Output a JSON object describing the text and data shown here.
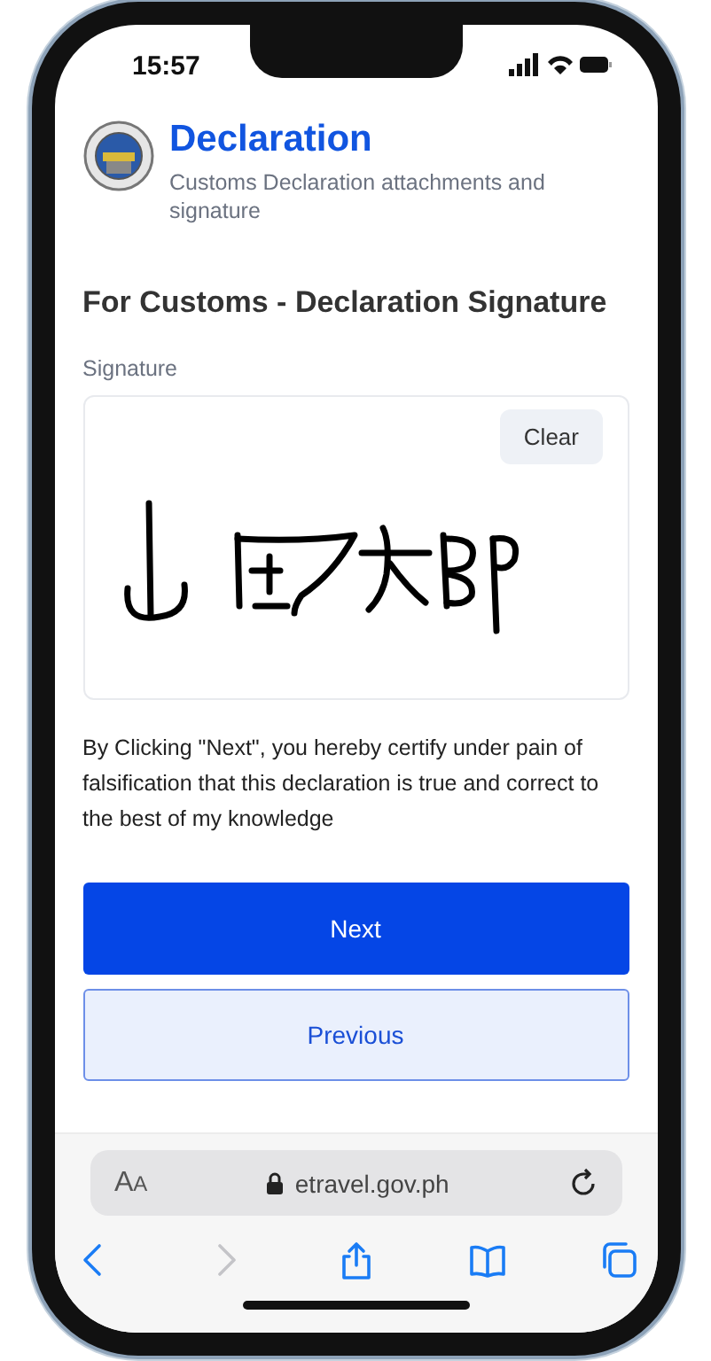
{
  "status_bar": {
    "time": "15:57"
  },
  "header": {
    "title": "Declaration",
    "subtitle": "Customs Declaration attachments and signature"
  },
  "section_title": "For Customs - Declaration Signature",
  "signature": {
    "label": "Signature",
    "clear_button": "Clear"
  },
  "certification": "By Clicking \"Next\", you hereby certify under pain of falsification that this declaration is true and correct to the best of my knowledge",
  "buttons": [
    {
      "label": "Next",
      "kind": "primary"
    },
    {
      "label": "Previous",
      "kind": "secondary"
    }
  ],
  "browser": {
    "text_size_button": "AA",
    "url": "etravel.gov.ph",
    "toolbar": [
      {
        "kind": "back",
        "disabled": false
      },
      {
        "kind": "forward",
        "disabled": true
      },
      {
        "kind": "share",
        "disabled": false
      },
      {
        "kind": "bookmarks",
        "disabled": false
      },
      {
        "kind": "tabs",
        "disabled": false
      }
    ]
  }
}
